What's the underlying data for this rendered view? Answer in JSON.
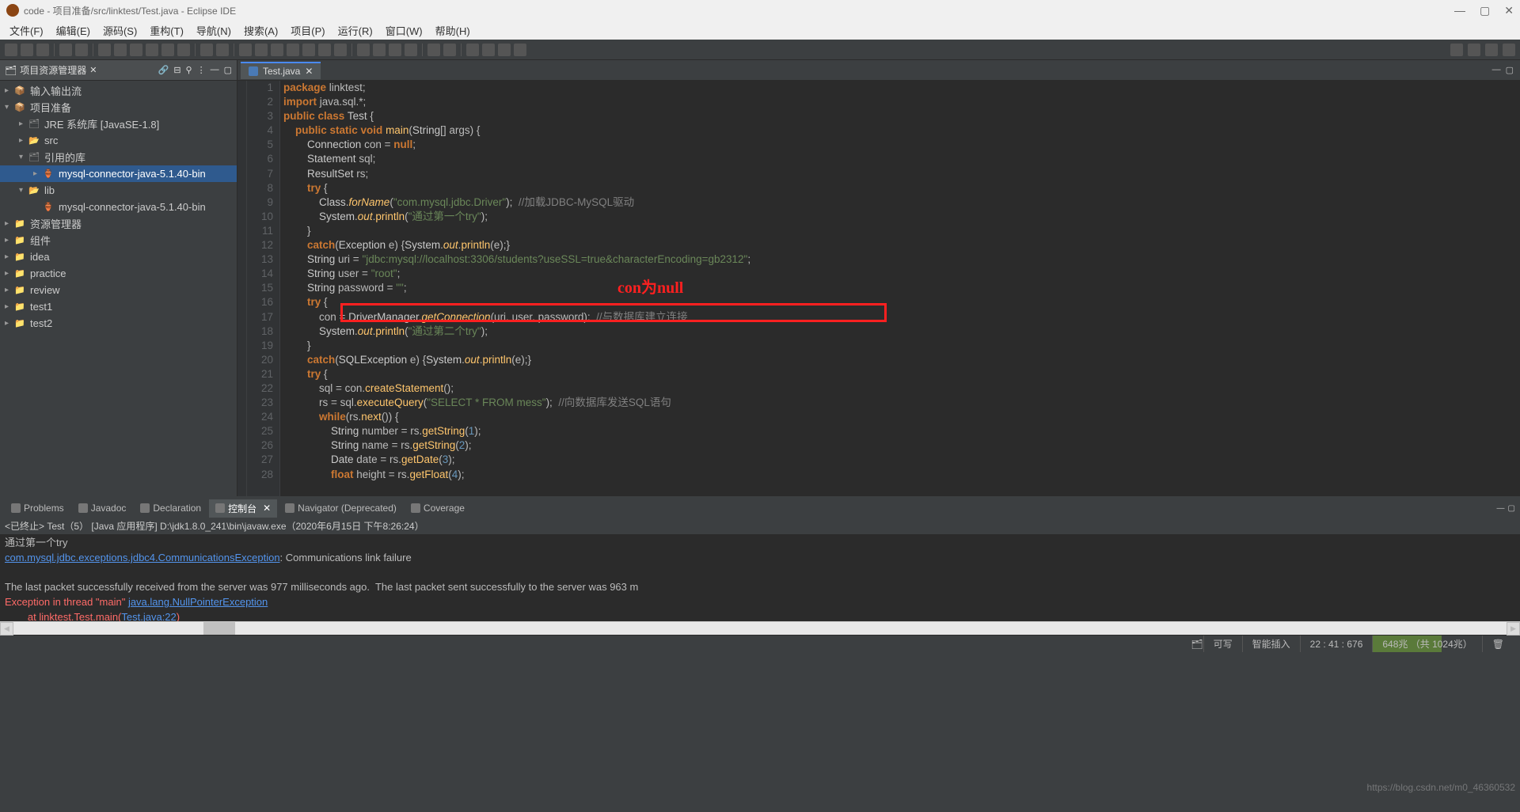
{
  "window": {
    "title": "code - 项目准备/src/linktest/Test.java - Eclipse IDE"
  },
  "menu": {
    "file": "文件(F)",
    "edit": "编辑(E)",
    "source": "源码(S)",
    "refactor": "重构(T)",
    "navigate": "导航(N)",
    "search": "搜索(A)",
    "project": "项目(P)",
    "run": "运行(R)",
    "window": "窗口(W)",
    "help": "帮助(H)"
  },
  "sidebar": {
    "title": "项目资源管理器",
    "tree": [
      {
        "indent": 0,
        "exp": "▸",
        "icon": "📦",
        "cls": "package",
        "label": "输入输出流"
      },
      {
        "indent": 0,
        "exp": "▾",
        "icon": "📦",
        "cls": "package",
        "label": "项目准备"
      },
      {
        "indent": 1,
        "exp": "▸",
        "icon": "🗂",
        "cls": "jar",
        "label": "JRE 系统库 [JavaSE-1.8]"
      },
      {
        "indent": 1,
        "exp": "▸",
        "icon": "📂",
        "cls": "folder",
        "label": "src"
      },
      {
        "indent": 1,
        "exp": "▾",
        "icon": "🗂",
        "cls": "jar",
        "label": "引用的库"
      },
      {
        "indent": 2,
        "exp": "▸",
        "icon": "🏺",
        "cls": "jar",
        "label": "mysql-connector-java-5.1.40-bin",
        "selected": true
      },
      {
        "indent": 1,
        "exp": "▾",
        "icon": "📂",
        "cls": "folder",
        "label": "lib"
      },
      {
        "indent": 2,
        "exp": "",
        "icon": "🏺",
        "cls": "jar",
        "label": "mysql-connector-java-5.1.40-bin"
      },
      {
        "indent": 0,
        "exp": "▸",
        "icon": "📁",
        "cls": "folder",
        "label": "资源管理器"
      },
      {
        "indent": 0,
        "exp": "▸",
        "icon": "📁",
        "cls": "folder",
        "label": "组件"
      },
      {
        "indent": 0,
        "exp": "▸",
        "icon": "📁",
        "cls": "folder",
        "label": "idea"
      },
      {
        "indent": 0,
        "exp": "▸",
        "icon": "📁",
        "cls": "folder",
        "label": "practice"
      },
      {
        "indent": 0,
        "exp": "▸",
        "icon": "📁",
        "cls": "folder",
        "label": "review"
      },
      {
        "indent": 0,
        "exp": "▸",
        "icon": "📁",
        "cls": "folder",
        "label": "test1"
      },
      {
        "indent": 0,
        "exp": "▸",
        "icon": "📁",
        "cls": "folder",
        "label": "test2"
      }
    ]
  },
  "editor": {
    "tab": "Test.java",
    "annotation": "con为null",
    "lines": [
      {
        "n": 1,
        "html": "<span class='kw'>package</span> linktest;"
      },
      {
        "n": 2,
        "html": "<span class='kw'>import</span> java.sql.*;"
      },
      {
        "n": 3,
        "html": "<span class='kw'>public class</span> <span class='typ'>Test</span> {"
      },
      {
        "n": 4,
        "html": "    <span class='kw'>public static void</span> <span class='mth'>main</span>(<span class='typ'>String</span>[] args) {"
      },
      {
        "n": 5,
        "html": "        <span class='typ'>Connection</span> con = <span class='kw'>null</span>;"
      },
      {
        "n": 6,
        "html": "        <span class='typ'>Statement</span> sql;"
      },
      {
        "n": 7,
        "html": "        <span class='typ'>ResultSet</span> rs;"
      },
      {
        "n": 8,
        "html": "        <span class='kw'>try</span> {"
      },
      {
        "n": 9,
        "html": "            <span class='typ'>Class</span>.<span class='mthi'>forName</span>(<span class='str'>\"com.mysql.jdbc.Driver\"</span>);  <span class='cmt'>//加载JDBC-MySQL驱动</span>"
      },
      {
        "n": 10,
        "html": "            <span class='typ'>System</span>.<span class='mthi'>out</span>.<span class='mth'>println</span>(<span class='str'>\"通过第一个try\"</span>);"
      },
      {
        "n": 11,
        "html": "        }"
      },
      {
        "n": 12,
        "html": "        <span class='kw'>catch</span>(<span class='typ'>Exception</span> e) {<span class='typ'>System</span>.<span class='mthi'>out</span>.<span class='mth'>println</span>(e);}"
      },
      {
        "n": 13,
        "html": "        <span class='typ'>String</span> uri = <span class='str'>\"jdbc:mysql://localhost:3306/students?useSSL=true&amp;characterEncoding=gb2312\"</span>;"
      },
      {
        "n": 14,
        "html": "        <span class='typ'>String</span> user = <span class='str'>\"root\"</span>;"
      },
      {
        "n": 15,
        "html": "        <span class='typ'>String</span> password = <span class='str'>\"\"</span>;"
      },
      {
        "n": 16,
        "html": "        <span class='kw'>try</span> {"
      },
      {
        "n": 17,
        "html": "            con = <span class='typ'>DriverManager</span>.<span class='mthi'>getConnection</span>(uri, user, password);  <span class='cmt'>//与数据库建立连接</span>"
      },
      {
        "n": 18,
        "html": "            <span class='typ'>System</span>.<span class='mthi'>out</span>.<span class='mth'>println</span>(<span class='str'>\"通过第二个try\"</span>);"
      },
      {
        "n": 19,
        "html": "        }"
      },
      {
        "n": 20,
        "html": "        <span class='kw'>catch</span>(<span class='typ'>SQLException</span> e) {<span class='typ'>System</span>.<span class='mthi'>out</span>.<span class='mth'>println</span>(e);}"
      },
      {
        "n": 21,
        "html": "        <span class='kw'>try</span> {"
      },
      {
        "n": 22,
        "html": "            sql = con.<span class='mth'>createStatement</span>();"
      },
      {
        "n": 23,
        "html": "            rs = sql.<span class='mth'>executeQuery</span>(<span class='str'>\"SELECT * FROM mess\"</span>);  <span class='cmt'>//向数据库发送SQL语句</span>"
      },
      {
        "n": 24,
        "html": "            <span class='kw'>while</span>(rs.<span class='mth'>next</span>()) {"
      },
      {
        "n": 25,
        "html": "                <span class='typ'>String</span> number = rs.<span class='mth'>getString</span>(<span class='num'>1</span>);"
      },
      {
        "n": 26,
        "html": "                <span class='typ'>String</span> name = rs.<span class='mth'>getString</span>(<span class='num'>2</span>);"
      },
      {
        "n": 27,
        "html": "                <span class='typ'>Date</span> date = rs.<span class='mth'>getDate</span>(<span class='num'>3</span>);"
      },
      {
        "n": 28,
        "html": "                <span class='kw'>float</span> height = rs.<span class='mth'>getFloat</span>(<span class='num'>4</span>);"
      }
    ]
  },
  "bottomTabs": {
    "problems": "Problems",
    "javadoc": "Javadoc",
    "declaration": "Declaration",
    "console": "控制台",
    "navigator": "Navigator (Deprecated)",
    "coverage": "Coverage"
  },
  "console": {
    "header": "<已终止> Test（5） [Java 应用程序] D:\\jdk1.8.0_241\\bin\\javaw.exe（2020年6月15日 下午8:26:24）",
    "line1": "通过第一个try",
    "line2a": "com.mysql.jdbc.exceptions.jdbc4.CommunicationsException",
    "line2b": ": Communications link failure",
    "line3": "The last packet successfully received from the server was 977 milliseconds ago.  The last packet sent successfully to the server was 963 m",
    "line4a": "Exception in thread \"main\" ",
    "line4b": "java.lang.NullPointerException",
    "line5a": "        at linktest.Test.main(",
    "line5b": "Test.java:22",
    "line5c": ")"
  },
  "status": {
    "writable": "可写",
    "insert": "智能插入",
    "cursor": "22 : 41 : 676",
    "memory": "648兆 （共 1024兆）"
  },
  "watermark": "https://blog.csdn.net/m0_46360532"
}
